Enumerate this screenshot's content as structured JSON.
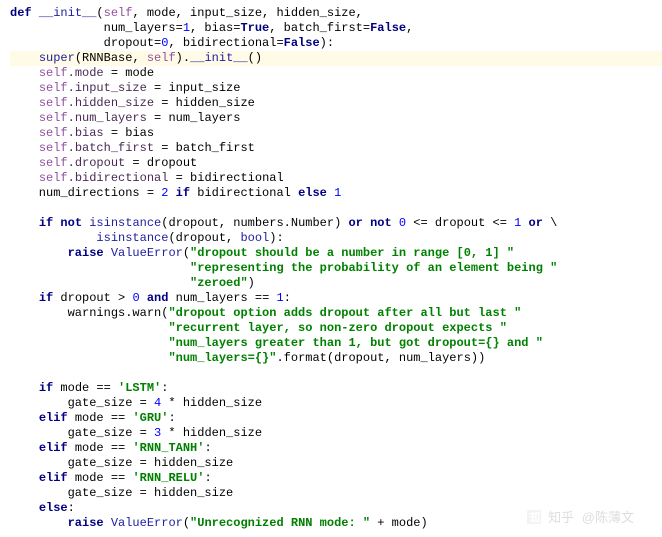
{
  "watermark": {
    "site": "知乎",
    "author": "@陈薄文"
  },
  "code": {
    "lines": [
      {
        "cls": "",
        "tokens": [
          [
            "kw",
            "def"
          ],
          [
            "op",
            " "
          ],
          [
            "fn",
            "__init__"
          ],
          [
            "op",
            "("
          ],
          [
            "self",
            "self"
          ],
          [
            "op",
            ", mode, input_size, hidden_size,"
          ]
        ]
      },
      {
        "cls": "",
        "tokens": [
          [
            "op",
            "             num_layers="
          ],
          [
            "num",
            "1"
          ],
          [
            "op",
            ", bias="
          ],
          [
            "flit",
            "True"
          ],
          [
            "op",
            ", batch_first="
          ],
          [
            "flit",
            "False"
          ],
          [
            "op",
            ","
          ]
        ]
      },
      {
        "cls": "",
        "tokens": [
          [
            "op",
            "             dropout="
          ],
          [
            "num",
            "0"
          ],
          [
            "op",
            ", bidirectional="
          ],
          [
            "flit",
            "False"
          ],
          [
            "op",
            "):"
          ]
        ]
      },
      {
        "cls": "hl",
        "tokens": [
          [
            "op",
            "    "
          ],
          [
            "fn",
            "super"
          ],
          [
            "op",
            "(RNNBase, "
          ],
          [
            "self",
            "self"
          ],
          [
            "op",
            ")."
          ],
          [
            "fn",
            "__init__"
          ],
          [
            "op",
            "()"
          ]
        ]
      },
      {
        "cls": "",
        "tokens": [
          [
            "op",
            "    "
          ],
          [
            "self",
            "self"
          ],
          [
            "attr",
            ".mode"
          ],
          [
            "op",
            " = mode"
          ]
        ]
      },
      {
        "cls": "",
        "tokens": [
          [
            "op",
            "    "
          ],
          [
            "self",
            "self"
          ],
          [
            "attr",
            ".input_size"
          ],
          [
            "op",
            " = input_size"
          ]
        ]
      },
      {
        "cls": "",
        "tokens": [
          [
            "op",
            "    "
          ],
          [
            "self",
            "self"
          ],
          [
            "attr",
            ".hidden_size"
          ],
          [
            "op",
            " = hidden_size"
          ]
        ]
      },
      {
        "cls": "",
        "tokens": [
          [
            "op",
            "    "
          ],
          [
            "self",
            "self"
          ],
          [
            "attr",
            ".num_layers"
          ],
          [
            "op",
            " = num_layers"
          ]
        ]
      },
      {
        "cls": "",
        "tokens": [
          [
            "op",
            "    "
          ],
          [
            "self",
            "self"
          ],
          [
            "attr",
            ".bias"
          ],
          [
            "op",
            " = bias"
          ]
        ]
      },
      {
        "cls": "",
        "tokens": [
          [
            "op",
            "    "
          ],
          [
            "self",
            "self"
          ],
          [
            "attr",
            ".batch_first"
          ],
          [
            "op",
            " = batch_first"
          ]
        ]
      },
      {
        "cls": "",
        "tokens": [
          [
            "op",
            "    "
          ],
          [
            "self",
            "self"
          ],
          [
            "attr",
            ".dropout"
          ],
          [
            "op",
            " = dropout"
          ]
        ]
      },
      {
        "cls": "",
        "tokens": [
          [
            "op",
            "    "
          ],
          [
            "self",
            "self"
          ],
          [
            "attr",
            ".bidirectional"
          ],
          [
            "op",
            " = bidirectional"
          ]
        ]
      },
      {
        "cls": "",
        "tokens": [
          [
            "op",
            "    num_directions = "
          ],
          [
            "num",
            "2"
          ],
          [
            "op",
            " "
          ],
          [
            "kw",
            "if"
          ],
          [
            "op",
            " bidirectional "
          ],
          [
            "kw",
            "else"
          ],
          [
            "op",
            " "
          ],
          [
            "num",
            "1"
          ]
        ]
      },
      {
        "cls": "",
        "tokens": []
      },
      {
        "cls": "",
        "tokens": [
          [
            "op",
            "    "
          ],
          [
            "kw",
            "if not"
          ],
          [
            "op",
            " "
          ],
          [
            "fn",
            "isinstance"
          ],
          [
            "op",
            "(dropout, numbers.Number) "
          ],
          [
            "kw",
            "or not"
          ],
          [
            "op",
            " "
          ],
          [
            "num",
            "0"
          ],
          [
            "op",
            " <= dropout <= "
          ],
          [
            "num",
            "1"
          ],
          [
            "op",
            " "
          ],
          [
            "kw",
            "or"
          ],
          [
            "op",
            " \\ "
          ]
        ]
      },
      {
        "cls": "",
        "tokens": [
          [
            "op",
            "            "
          ],
          [
            "fn",
            "isinstance"
          ],
          [
            "op",
            "(dropout, "
          ],
          [
            "fn",
            "bool"
          ],
          [
            "op",
            "):"
          ]
        ]
      },
      {
        "cls": "",
        "tokens": [
          [
            "op",
            "        "
          ],
          [
            "kw",
            "raise"
          ],
          [
            "op",
            " "
          ],
          [
            "fn",
            "ValueError"
          ],
          [
            "op",
            "("
          ],
          [
            "str",
            "\"dropout should be a number in range [0, 1] \""
          ]
        ]
      },
      {
        "cls": "",
        "tokens": [
          [
            "op",
            "                         "
          ],
          [
            "str",
            "\"representing the probability of an element being \""
          ]
        ]
      },
      {
        "cls": "",
        "tokens": [
          [
            "op",
            "                         "
          ],
          [
            "str",
            "\"zeroed\""
          ],
          [
            "op",
            ")"
          ]
        ]
      },
      {
        "cls": "",
        "tokens": [
          [
            "op",
            "    "
          ],
          [
            "kw",
            "if"
          ],
          [
            "op",
            " dropout > "
          ],
          [
            "num",
            "0"
          ],
          [
            "op",
            " "
          ],
          [
            "kw",
            "and"
          ],
          [
            "op",
            " num_layers == "
          ],
          [
            "num",
            "1"
          ],
          [
            "op",
            ":"
          ]
        ]
      },
      {
        "cls": "",
        "tokens": [
          [
            "op",
            "        warnings.warn("
          ],
          [
            "str",
            "\"dropout option adds dropout after all but last \""
          ]
        ]
      },
      {
        "cls": "",
        "tokens": [
          [
            "op",
            "                      "
          ],
          [
            "str",
            "\"recurrent layer, so non-zero dropout expects \""
          ]
        ]
      },
      {
        "cls": "",
        "tokens": [
          [
            "op",
            "                      "
          ],
          [
            "str",
            "\"num_layers greater than 1, but got dropout={} and \""
          ]
        ]
      },
      {
        "cls": "",
        "tokens": [
          [
            "op",
            "                      "
          ],
          [
            "str",
            "\"num_layers={}\""
          ],
          [
            "op",
            ".format(dropout, num_layers))"
          ]
        ]
      },
      {
        "cls": "",
        "tokens": []
      },
      {
        "cls": "",
        "tokens": [
          [
            "op",
            "    "
          ],
          [
            "kw",
            "if"
          ],
          [
            "op",
            " mode == "
          ],
          [
            "str",
            "'LSTM'"
          ],
          [
            "op",
            ":"
          ]
        ]
      },
      {
        "cls": "",
        "tokens": [
          [
            "op",
            "        gate_size = "
          ],
          [
            "num",
            "4"
          ],
          [
            "op",
            " * hidden_size"
          ]
        ]
      },
      {
        "cls": "",
        "tokens": [
          [
            "op",
            "    "
          ],
          [
            "kw",
            "elif"
          ],
          [
            "op",
            " mode == "
          ],
          [
            "str",
            "'GRU'"
          ],
          [
            "op",
            ":"
          ]
        ]
      },
      {
        "cls": "",
        "tokens": [
          [
            "op",
            "        gate_size = "
          ],
          [
            "num",
            "3"
          ],
          [
            "op",
            " * hidden_size"
          ]
        ]
      },
      {
        "cls": "",
        "tokens": [
          [
            "op",
            "    "
          ],
          [
            "kw",
            "elif"
          ],
          [
            "op",
            " mode == "
          ],
          [
            "str",
            "'RNN_TANH'"
          ],
          [
            "op",
            ":"
          ]
        ]
      },
      {
        "cls": "",
        "tokens": [
          [
            "op",
            "        gate_size = hidden_size"
          ]
        ]
      },
      {
        "cls": "",
        "tokens": [
          [
            "op",
            "    "
          ],
          [
            "kw",
            "elif"
          ],
          [
            "op",
            " mode == "
          ],
          [
            "str",
            "'RNN_RELU'"
          ],
          [
            "op",
            ":"
          ]
        ]
      },
      {
        "cls": "",
        "tokens": [
          [
            "op",
            "        gate_size = hidden_size"
          ]
        ]
      },
      {
        "cls": "",
        "tokens": [
          [
            "op",
            "    "
          ],
          [
            "kw",
            "else"
          ],
          [
            "op",
            ":"
          ]
        ]
      },
      {
        "cls": "",
        "tokens": [
          [
            "op",
            "        "
          ],
          [
            "kw",
            "raise"
          ],
          [
            "op",
            " "
          ],
          [
            "fn",
            "ValueError"
          ],
          [
            "op",
            "("
          ],
          [
            "str",
            "\"Unrecognized RNN mode: \""
          ],
          [
            "op",
            " + mode)"
          ]
        ]
      }
    ]
  }
}
